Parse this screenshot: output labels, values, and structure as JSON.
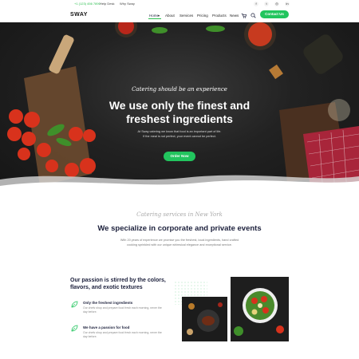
{
  "topbar": {
    "phone": "+1 (123) 456 7890",
    "help": "Help Desk",
    "why": "Why Sway",
    "social": [
      {
        "name": "facebook-icon",
        "glyph": "f"
      },
      {
        "name": "twitter-icon",
        "glyph": "t"
      },
      {
        "name": "instagram-icon",
        "glyph": "◎"
      },
      {
        "name": "linkedin-icon",
        "glyph": "in"
      }
    ]
  },
  "nav": {
    "logo": "SWAY",
    "items": [
      "Home",
      "About",
      "Services",
      "Pricing",
      "Products",
      "News"
    ],
    "active": "Home",
    "contact_label": "Contact Us"
  },
  "hero": {
    "script": "Catering should be an experience",
    "title_line1": "We use only the finest and",
    "title_line2": "freshest ingredients",
    "desc_line1": "At Sway catering we know that food is an important part of life.",
    "desc_line2": "If the meal is not perfect, your event cannot be perfect.",
    "button": "Order Now"
  },
  "services": {
    "script": "Catering services in New York",
    "title": "We specialize in corporate and private events",
    "desc_line1": "With 20 years of experience we promise you the freshest, local ingredients, hand crafted",
    "desc_line2": "cooking sprinkled with our unique whimsical elegance and exceptional service."
  },
  "passion": {
    "title": "Our passion is stirred by the colors, flavors, and exotic textures",
    "features": [
      {
        "title": "Only the freshest ingredients",
        "desc": "Our chefs shop and prepare food fresh each morning, never the day before."
      },
      {
        "title": "We have a passion for food",
        "desc": "Our chefs shop and prepare food fresh each morning, never the day before."
      }
    ]
  },
  "colors": {
    "accent": "#22c55e",
    "navy": "#1b1f3b"
  }
}
